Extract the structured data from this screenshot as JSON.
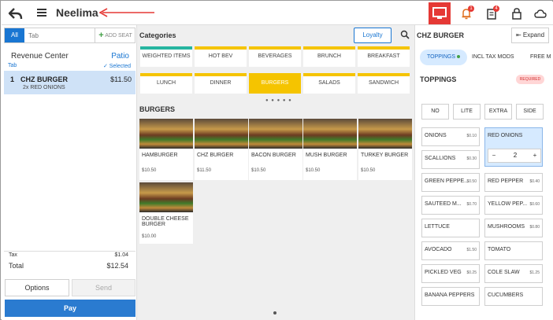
{
  "header": {
    "title": "Neelima",
    "back_icon": "back-arrow-icon",
    "menu_icon": "hamburger-menu-icon",
    "bell_badge": "1",
    "orders_badge": "4",
    "monitor_color": "#e53935"
  },
  "order_panel": {
    "tab_all": "All",
    "tab_placeholder": "Tab",
    "add_seat": "ADD SEAT",
    "revenue_center": "Revenue Center",
    "revenue_tab": "Tab",
    "location": "Patio",
    "selected": "Selected",
    "lines": [
      {
        "qty": "1",
        "name": "CHZ BURGER",
        "price": "$11.50",
        "modifier": "2x RED ONIONS"
      }
    ],
    "tax_label": "Tax",
    "tax_value": "$1.04",
    "total_label": "Total",
    "total_value": "$12.54",
    "options_label": "Options",
    "send_label": "Send",
    "pay_label": "Pay"
  },
  "menu": {
    "categories_title": "Categories",
    "loyalty_label": "Loyalty",
    "categories": [
      {
        "label": "WEIGHTED ITEMS",
        "color": "#26b5a0",
        "active": false
      },
      {
        "label": "HOT BEV",
        "color": "#f5c400",
        "active": false
      },
      {
        "label": "BEVERAGES",
        "color": "#f5c400",
        "active": false
      },
      {
        "label": "BRUNCH",
        "color": "#f5c400",
        "active": false
      },
      {
        "label": "BREAKFAST",
        "color": "#f5c400",
        "active": false
      },
      {
        "label": "LUNCH",
        "color": "#f5c400",
        "active": false
      },
      {
        "label": "DINNER",
        "color": "#f5c400",
        "active": false
      },
      {
        "label": "BURGERS",
        "color": "#f5c400",
        "active": true
      },
      {
        "label": "SALADS",
        "color": "#f5c400",
        "active": false
      },
      {
        "label": "SANDWICH",
        "color": "#f5c400",
        "active": false
      }
    ],
    "group_title": "BURGERS",
    "items": [
      {
        "name": "HAMBURGER",
        "price": "$10.50"
      },
      {
        "name": "CHZ BURGER",
        "price": "$11.50"
      },
      {
        "name": "BACON BURGER",
        "price": "$10.50"
      },
      {
        "name": "MUSH BURGER",
        "price": "$10.50"
      },
      {
        "name": "TURKEY BURGER",
        "price": "$10.50"
      },
      {
        "name": "DOUBLE CHEESE BURGER",
        "price": "$10.00"
      }
    ]
  },
  "modifiers": {
    "item_title": "CHZ BURGER",
    "expand_label": "Expand",
    "tabs": [
      "TOPPINGS",
      "INCL TAX MODS",
      "FREE M"
    ],
    "section_title": "TOPPINGS",
    "required_label": "REQUIRED",
    "portion_buttons": [
      "NO",
      "LITE",
      "EXTRA",
      "SIDE"
    ],
    "options": [
      {
        "name": "ONIONS",
        "price": "$0.10"
      },
      {
        "name": "RED ONIONS",
        "price": ""
      },
      {
        "name": "SCALLIONS",
        "price": "$0.30"
      },
      {
        "name": "GREEN PEPPE...",
        "price": "$0.50"
      },
      {
        "name": "RED PEPPER",
        "price": "$0.40"
      },
      {
        "name": "SAUTEED M...",
        "price": "$0.70"
      },
      {
        "name": "YELLOW PEP...",
        "price": "$0.60"
      },
      {
        "name": "LETTUCE",
        "price": ""
      },
      {
        "name": "MUSHROOMS",
        "price": "$0.80"
      },
      {
        "name": "AVOCADO",
        "price": "$1.50"
      },
      {
        "name": "TOMATO",
        "price": ""
      },
      {
        "name": "PICKLED VEG",
        "price": "$0.25"
      },
      {
        "name": "COLE SLAW",
        "price": "$1.25"
      },
      {
        "name": "BANANA PEPPERS",
        "price": ""
      },
      {
        "name": "CUCUMBERS",
        "price": ""
      }
    ],
    "selected_qty": "2",
    "minus": "−",
    "plus": "+"
  }
}
